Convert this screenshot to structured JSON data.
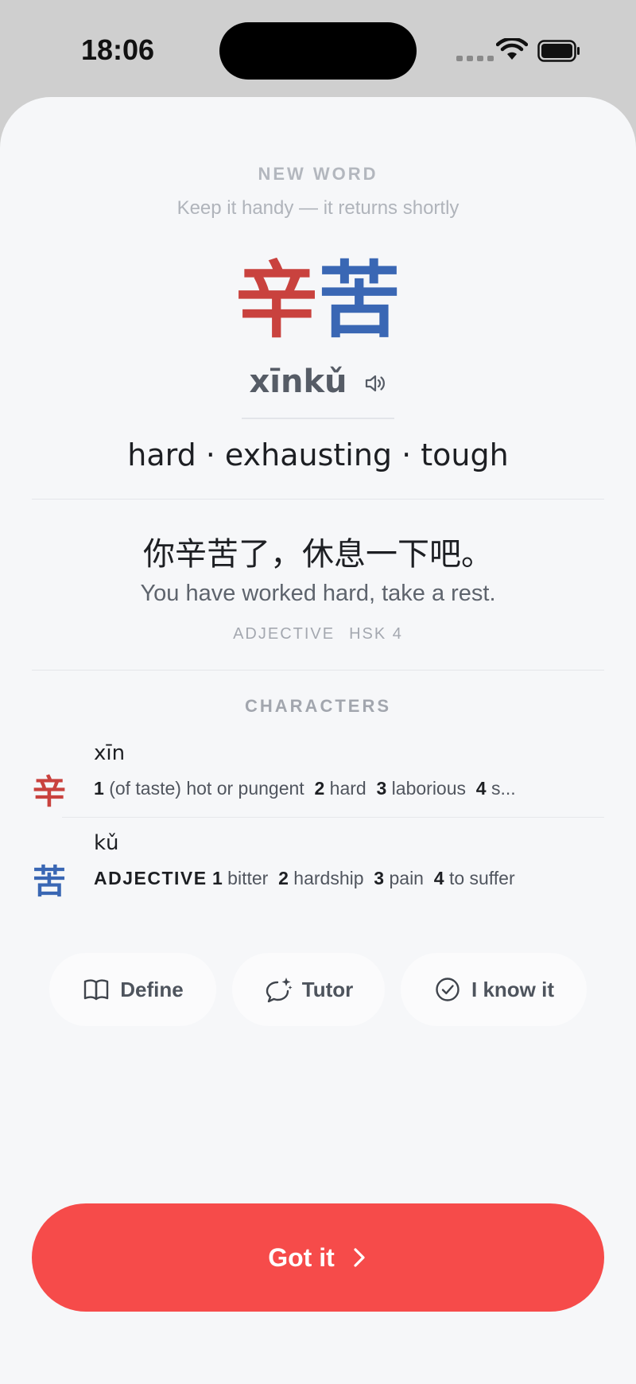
{
  "status_bar": {
    "time": "18:06"
  },
  "header": {
    "eyebrow": "NEW WORD",
    "subtitle": "Keep it handy — it returns shortly"
  },
  "word": {
    "char_1": "辛",
    "char_2": "苦",
    "pinyin": "xīnkǔ",
    "meanings": "hard · exhausting · tough",
    "colors": {
      "char_1": "#c9423e",
      "char_2": "#3a67b4"
    }
  },
  "example": {
    "chinese": "你辛苦了，休息一下吧。",
    "english": "You have worked hard, take a rest."
  },
  "tags": {
    "part_of_speech": "ADJECTIVE",
    "level": "HSK 4"
  },
  "characters": {
    "title": "CHARACTERS",
    "items": [
      {
        "glyph": "辛",
        "pinyin": "xīn",
        "defs": [
          {
            "num": "1",
            "text": "(of taste) hot or pungent"
          },
          {
            "num": "2",
            "text": "hard"
          },
          {
            "num": "3",
            "text": "laborious"
          },
          {
            "num": "4",
            "text": "s..."
          }
        ]
      },
      {
        "glyph": "苦",
        "pinyin": "kǔ",
        "pos": "ADJECTIVE",
        "defs": [
          {
            "num": "1",
            "text": "bitter"
          },
          {
            "num": "2",
            "text": "hardship"
          },
          {
            "num": "3",
            "text": "pain"
          },
          {
            "num": "4",
            "text": "to suffer"
          }
        ]
      }
    ]
  },
  "actions": {
    "define": "Define",
    "tutor": "Tutor",
    "known": "I know it"
  },
  "primary_button": {
    "label": "Got it",
    "color": "#f64b4a"
  }
}
